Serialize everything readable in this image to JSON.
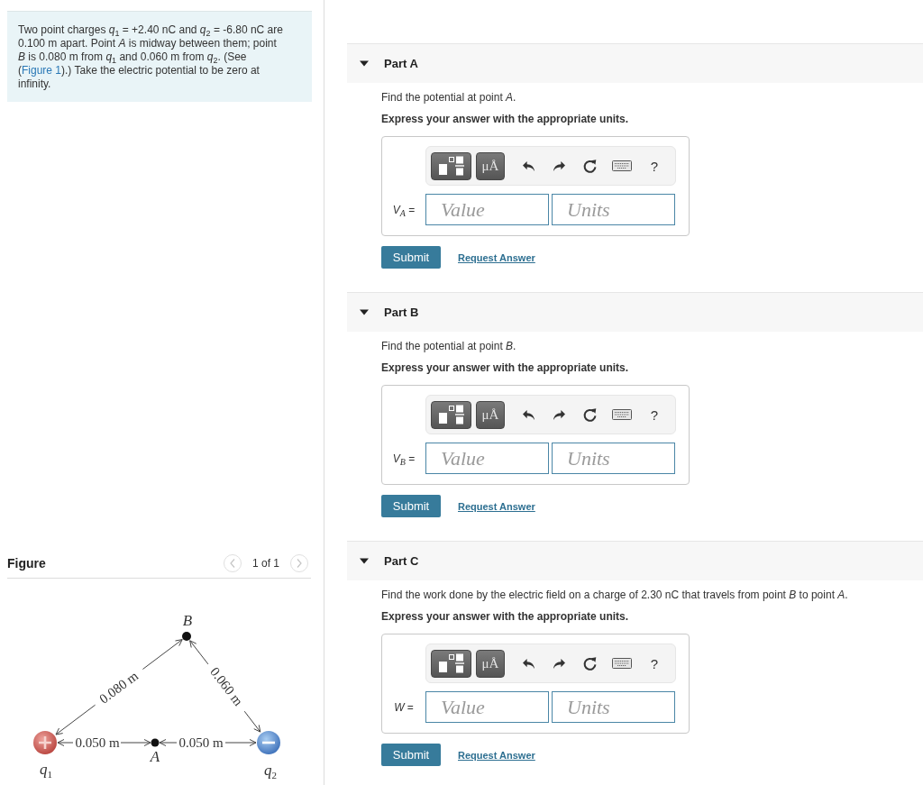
{
  "problem": {
    "text_before": "Two point charges *q*$_{1}$ = +2.40 nC and *q*$_{2}$ = -6.80 nC are 0.100 m apart. Point *A* is midway between them; point *B* is 0.080 m from *q*$_{1}$ and 0.060 m from *q*$_{2}$. (See (",
    "link": "Figure 1",
    "text_after": ").) Take the electric potential to be zero at infinity."
  },
  "figure": {
    "title": "Figure",
    "pager": {
      "text": "1 of 1",
      "prev": {
        "disabled": true
      },
      "next": {
        "disabled": true
      }
    },
    "charges": [
      {
        "kind": "positive",
        "label": "*q*$_{1}$"
      },
      {
        "kind": "negative",
        "label": "*q*$_{2}$"
      }
    ],
    "points": [
      {
        "label": "B"
      },
      {
        "label": "A"
      }
    ],
    "distances": [
      "0.080 m",
      "0.060 m",
      "0.050 m",
      "0.050 m"
    ]
  },
  "parts": [
    {
      "title": "Part A",
      "expanded": true,
      "question": "Find the potential at point *A*.",
      "instruction": "Express your answer with the appropriate units.",
      "answer_label": "*V*$_{A}$ =",
      "value_placeholder": "Value",
      "units_placeholder": "Units",
      "units_button": "μÅ",
      "help_button": "?",
      "submit": "Submit",
      "request_answer": "Request Answer"
    },
    {
      "title": "Part B",
      "expanded": true,
      "question": "Find the potential at point *B*.",
      "instruction": "Express your answer with the appropriate units.",
      "answer_label": "*V*$_{B}$ =",
      "value_placeholder": "Value",
      "units_placeholder": "Units",
      "units_button": "μÅ",
      "help_button": "?",
      "submit": "Submit",
      "request_answer": "Request Answer"
    },
    {
      "title": "Part C",
      "expanded": true,
      "question": "Find the work done by the electric field on a charge of 2.30 nC that travels from point *B* to point *A*.",
      "instruction": "Express your answer with the appropriate units.",
      "answer_label": "*W* =",
      "value_placeholder": "Value",
      "units_placeholder": "Units",
      "units_button": "μÅ",
      "help_button": "?",
      "submit": "Submit",
      "request_answer": "Request Answer"
    }
  ]
}
